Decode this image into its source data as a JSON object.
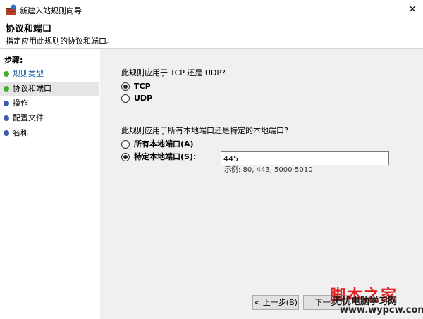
{
  "window": {
    "title": "新建入站规则向导",
    "close_glyph": "✕"
  },
  "header": {
    "title": "协议和端口",
    "subtitle": "指定应用此规则的协议和端口。"
  },
  "sidebar": {
    "steps_title": "步骤:",
    "items": [
      {
        "label": "规则类型"
      },
      {
        "label": "协议和端口"
      },
      {
        "label": "操作"
      },
      {
        "label": "配置文件"
      },
      {
        "label": "名称"
      }
    ]
  },
  "main": {
    "protocol_question": "此规则应用于 TCP 还是 UDP?",
    "tcp_label": "TCP",
    "udp_label": "UDP",
    "port_question": "此规则应用于所有本地端口还是特定的本地端口?",
    "all_ports_label": "所有本地端口(A)",
    "specific_ports_label": "特定本地端口(S):",
    "port_value": "445",
    "example_text": "示例: 80, 443, 5000-5010"
  },
  "buttons": {
    "back": "< 上一步(B)",
    "next": "下一步"
  },
  "watermark": {
    "line1": "脚本之家",
    "line2": "无忧电脑学习网",
    "line3": "www.wypcw.com"
  },
  "colors": {
    "content_bg": "#f0f0f0",
    "step_done": "#3fae2a",
    "step_pending": "#3b5bb5",
    "link": "#0a5ba6"
  }
}
